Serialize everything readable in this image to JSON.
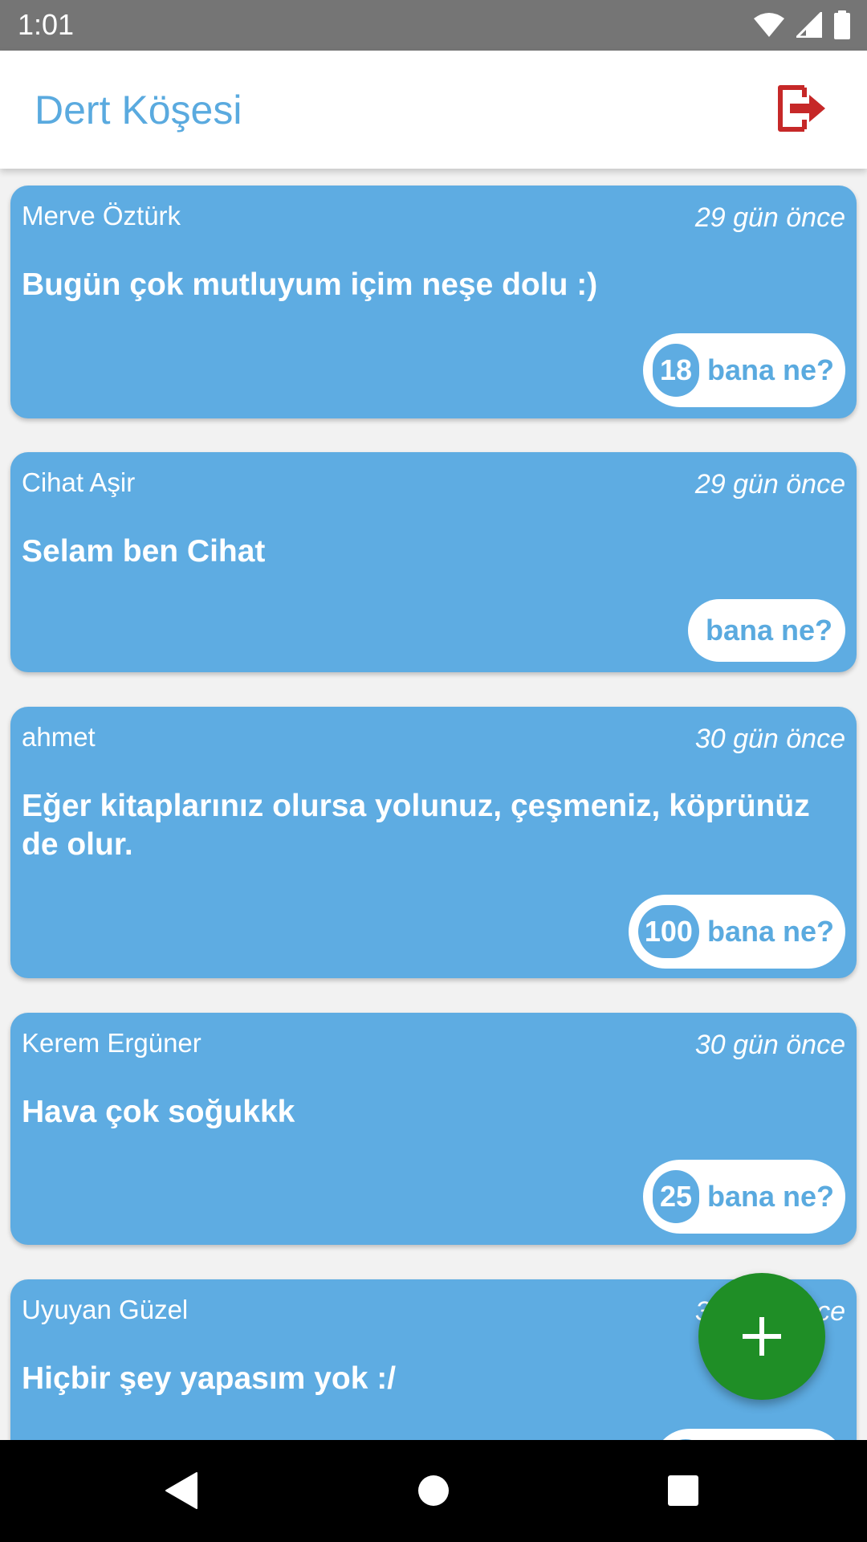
{
  "status_bar": {
    "time": "1:01",
    "icons": [
      "wifi-icon",
      "cell-signal-icon",
      "battery-icon"
    ]
  },
  "app_bar": {
    "title": "Dert Köşesi",
    "logout_icon": "logout-icon"
  },
  "colors": {
    "accent": "#5aaadf",
    "card": "#5eace2",
    "logout": "#c62828",
    "fab": "#1f8e26",
    "status_bar": "#757575"
  },
  "posts": [
    {
      "author": "Merve Öztürk",
      "time": "29 gün önce",
      "text": "Bugün çok mutluyum içim neşe dolu :)",
      "reaction_count": "18",
      "reaction_label": "bana ne?"
    },
    {
      "author": "Cihat Aşir",
      "time": "29 gün önce",
      "text": "Selam ben Cihat",
      "reaction_count": "",
      "reaction_label": "bana ne?"
    },
    {
      "author": "ahmet",
      "time": "30 gün önce",
      "text": "Eğer kitaplarınız olursa yolunuz, çeşmeniz, köprünüz de olur.",
      "reaction_count": "100",
      "reaction_label": "bana ne?"
    },
    {
      "author": "Kerem Ergüner",
      "time": "30 gün önce",
      "text": "Hava çok soğukkk",
      "reaction_count": "25",
      "reaction_label": "bana ne?"
    },
    {
      "author": "Uyuyan Güzel",
      "time": "30 gün önce",
      "text": "Hiçbir şey yapasım yok :/"
    }
  ],
  "fab": {
    "icon": "plus-icon"
  },
  "nav_bar": {
    "icons": [
      "back-icon",
      "home-icon",
      "recents-icon"
    ]
  }
}
